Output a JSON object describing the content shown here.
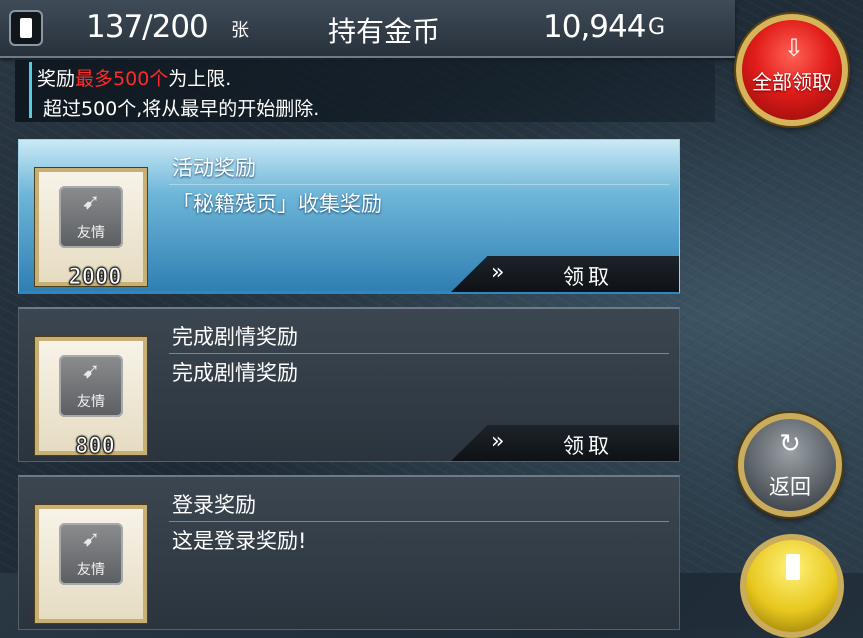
{
  "header": {
    "card_count": "137/200",
    "card_unit": "张",
    "coin_label": "持有金币",
    "coin_value": "10,944",
    "coin_unit": "G"
  },
  "notice": {
    "line1_prefix": "奖励",
    "line1_highlight": "最多500个",
    "line1_suffix": "为上限.",
    "line2": "超过500个,将从最早的开始删除.",
    "accent_color": "#53cde0",
    "highlight_color": "#ff2a2a"
  },
  "claim_all": {
    "label": "全部领取",
    "icon": "download-arrow-icon"
  },
  "rewards": [
    {
      "title": "活动奖励",
      "description": "「秘籍残页」收集奖励",
      "icon_label": "友情",
      "quantity": "2000",
      "claim_label": "领取",
      "active": true
    },
    {
      "title": "完成剧情奖励",
      "description": "完成剧情奖励",
      "icon_label": "友情",
      "quantity": "800",
      "claim_label": "领取",
      "active": false
    },
    {
      "title": "登录奖励",
      "description": "这是登录奖励!",
      "icon_label": "友情",
      "quantity": "",
      "claim_label": "",
      "active": false
    }
  ],
  "back_button": {
    "label": "返回",
    "icon": "refresh-arrow-icon"
  }
}
